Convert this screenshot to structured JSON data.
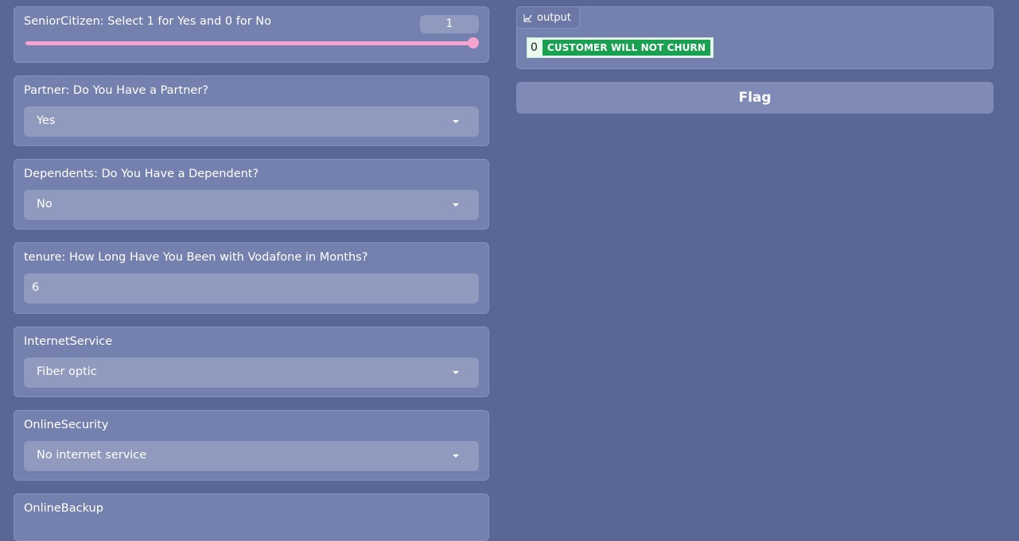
{
  "form": {
    "senior_citizen": {
      "label": "SeniorCitizen: Select 1 for Yes and 0 for No",
      "value": "1"
    },
    "partner": {
      "label": "Partner: Do You Have a Partner?",
      "value": "Yes"
    },
    "dependents": {
      "label": "Dependents: Do You Have a Dependent?",
      "value": "No"
    },
    "tenure": {
      "label": "tenure: How Long Have You Been with Vodafone in Months?",
      "value": "6"
    },
    "internet_service": {
      "label": "InternetService",
      "value": "Fiber optic"
    },
    "online_security": {
      "label": "OnlineSecurity",
      "value": "No internet service"
    },
    "online_backup": {
      "label": "OnlineBackup"
    }
  },
  "output": {
    "tab_label": "output",
    "index": "0",
    "result": "CUSTOMER WILL NOT CHURN"
  },
  "flag_button": {
    "label": "Flag"
  },
  "colors": {
    "background": "#5a6794",
    "card": "#7480ad",
    "slider_accent": "#f6a4cf",
    "result_badge": "#19a050"
  },
  "icons": {
    "output_tab": "chart-icon",
    "dropdown": "chevron-down-icon"
  }
}
